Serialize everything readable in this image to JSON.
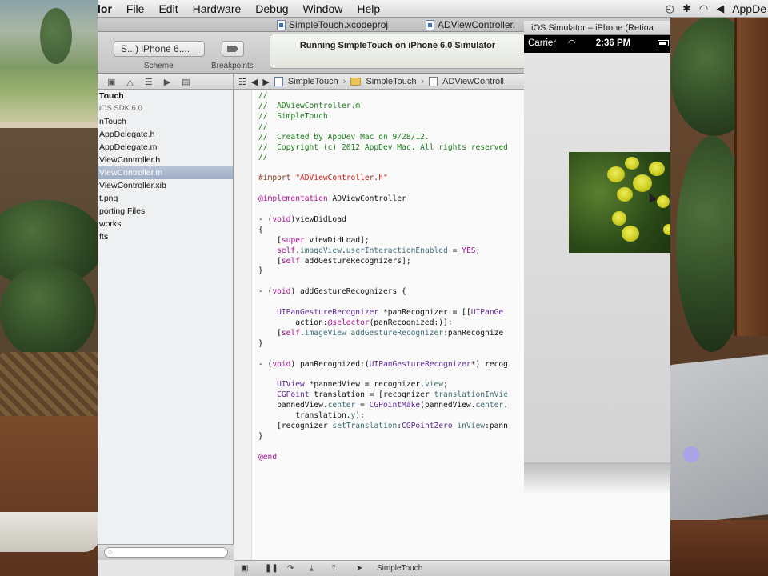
{
  "menubar": {
    "app_name": "lor",
    "items": [
      "File",
      "Edit",
      "Hardware",
      "Debug",
      "Window",
      "Help"
    ],
    "user": "AppDe"
  },
  "tabs": {
    "project_tab": "SimpleTouch.xcodeproj",
    "file_tab": "ADViewController.",
    "simulator_title": "iOS Simulator – iPhone (Retina"
  },
  "toolbar": {
    "scheme_value": "S...) iPhone 6....",
    "scheme_label": "Scheme",
    "breakpoints_label": "Breakpoints",
    "activity_text": "Running SimpleTouch on iPhone 6.0 Simulator"
  },
  "jumpbar": {
    "crumbs": [
      "SimpleTouch",
      "SimpleTouch",
      "ADViewControll"
    ]
  },
  "navigator": {
    "items": [
      {
        "label": "Touch",
        "style": "bold"
      },
      {
        "label": "iOS SDK 6.0",
        "style": "sub"
      },
      {
        "label": "nTouch",
        "style": ""
      },
      {
        "label": "AppDelegate.h",
        "style": ""
      },
      {
        "label": "AppDelegate.m",
        "style": ""
      },
      {
        "label": "ViewController.h",
        "style": ""
      },
      {
        "label": "ViewController.m",
        "style": "sel"
      },
      {
        "label": "ViewController.xib",
        "style": ""
      },
      {
        "label": "t.png",
        "style": ""
      },
      {
        "label": "porting Files",
        "style": ""
      },
      {
        "label": "works",
        "style": ""
      },
      {
        "label": "fts",
        "style": ""
      }
    ]
  },
  "debugbar": {
    "target": "SimpleTouch"
  },
  "simulator": {
    "carrier": "Carrier",
    "time": "2:36 PM"
  },
  "code": {
    "lines": [
      [
        [
          "//",
          "c"
        ]
      ],
      [
        [
          "//  ADViewController.m",
          "c"
        ]
      ],
      [
        [
          "//  SimpleTouch",
          "c"
        ]
      ],
      [
        [
          "//",
          "c"
        ]
      ],
      [
        [
          "//  Created by AppDev Mac on 9/28/12.",
          "c"
        ]
      ],
      [
        [
          "//  Copyright (c) 2012 AppDev Mac. All rights reserved",
          "c"
        ]
      ],
      [
        [
          "//",
          "c"
        ]
      ],
      [
        [
          "",
          ""
        ]
      ],
      [
        [
          "#import ",
          "p"
        ],
        [
          "\"ADViewController.h\"",
          "s"
        ]
      ],
      [
        [
          "",
          ""
        ]
      ],
      [
        [
          "@implementation",
          "k"
        ],
        [
          " ADViewController",
          ""
        ]
      ],
      [
        [
          "",
          ""
        ]
      ],
      [
        [
          "- (",
          ""
        ],
        [
          "void",
          "k"
        ],
        [
          ")viewDidLoad",
          ""
        ]
      ],
      [
        [
          "{",
          ""
        ]
      ],
      [
        [
          "    [",
          ""
        ],
        [
          "super",
          "k"
        ],
        [
          " viewDidLoad];",
          ""
        ]
      ],
      [
        [
          "    ",
          ""
        ],
        [
          "self",
          "k"
        ],
        [
          ".",
          ""
        ],
        [
          "imageView",
          "y"
        ],
        [
          ".",
          ""
        ],
        [
          "userInteractionEnabled",
          "y"
        ],
        [
          " = ",
          ""
        ],
        [
          "YES",
          "k"
        ],
        [
          ";",
          ""
        ]
      ],
      [
        [
          "    [",
          ""
        ],
        [
          "self",
          "k"
        ],
        [
          " addGestureRecognizers];",
          ""
        ]
      ],
      [
        [
          "}",
          ""
        ]
      ],
      [
        [
          "",
          ""
        ]
      ],
      [
        [
          "- (",
          ""
        ],
        [
          "void",
          "k"
        ],
        [
          ") addGestureRecognizers {",
          ""
        ]
      ],
      [
        [
          "",
          ""
        ]
      ],
      [
        [
          "    ",
          ""
        ],
        [
          "UIPanGestureRecognizer",
          "t"
        ],
        [
          " *panRecognizer = [[",
          ""
        ],
        [
          "UIPanGe",
          "t"
        ]
      ],
      [
        [
          "        action:",
          ""
        ],
        [
          "@selector",
          "k"
        ],
        [
          "(panRecognized:)];",
          ""
        ]
      ],
      [
        [
          "    [",
          ""
        ],
        [
          "self",
          "k"
        ],
        [
          ".",
          ""
        ],
        [
          "imageView",
          "y"
        ],
        [
          " ",
          ""
        ],
        [
          "addGestureRecognizer",
          "y"
        ],
        [
          ":panRecognize",
          ""
        ]
      ],
      [
        [
          "}",
          ""
        ]
      ],
      [
        [
          "",
          ""
        ]
      ],
      [
        [
          "- (",
          ""
        ],
        [
          "void",
          "k"
        ],
        [
          ") panRecognized:(",
          ""
        ],
        [
          "UIPanGestureRecognizer",
          "t"
        ],
        [
          "*) recog",
          ""
        ]
      ],
      [
        [
          "",
          ""
        ]
      ],
      [
        [
          "    ",
          ""
        ],
        [
          "UIView",
          "t"
        ],
        [
          " *pannedView = recognizer.",
          ""
        ],
        [
          "view",
          "y"
        ],
        [
          ";",
          ""
        ]
      ],
      [
        [
          "    ",
          ""
        ],
        [
          "CGPoint",
          "t"
        ],
        [
          " translation = [recognizer ",
          ""
        ],
        [
          "translationInVie",
          "y"
        ]
      ],
      [
        [
          "    pannedView.",
          ""
        ],
        [
          "center",
          "y"
        ],
        [
          " = ",
          ""
        ],
        [
          "CGPointMake",
          "t"
        ],
        [
          "(pannedView.",
          ""
        ],
        [
          "center",
          "y"
        ],
        [
          ".",
          ""
        ]
      ],
      [
        [
          "        translation.",
          ""
        ],
        [
          "y",
          "y"
        ],
        [
          ");",
          ""
        ]
      ],
      [
        [
          "    [recognizer ",
          ""
        ],
        [
          "setTranslation",
          "y"
        ],
        [
          ":",
          ""
        ],
        [
          "CGPointZero",
          "t"
        ],
        [
          " ",
          ""
        ],
        [
          "inView",
          "y"
        ],
        [
          ":pann",
          ""
        ]
      ],
      [
        [
          "}",
          ""
        ]
      ],
      [
        [
          "",
          ""
        ]
      ],
      [
        [
          "@end",
          "k"
        ]
      ]
    ]
  }
}
